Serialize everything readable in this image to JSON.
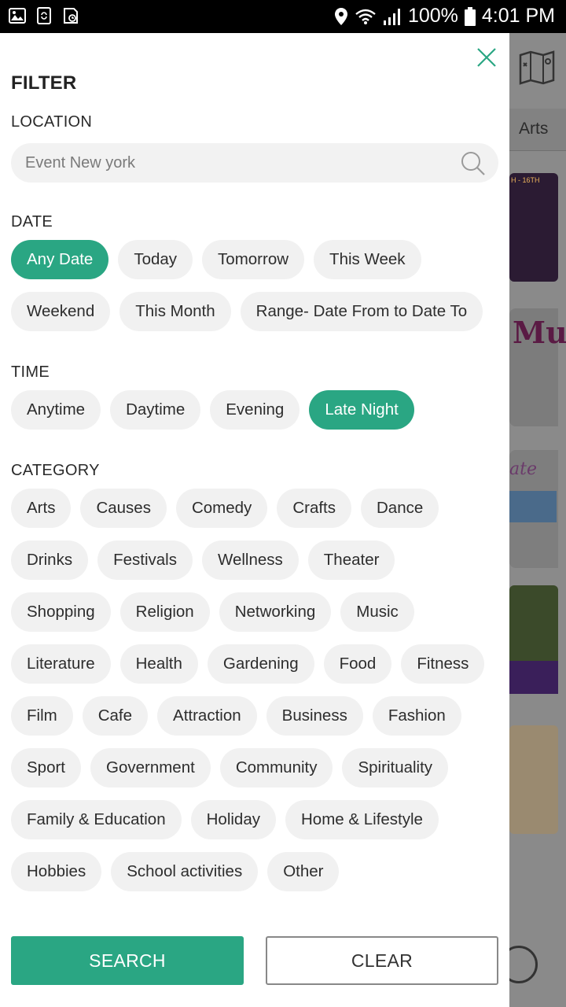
{
  "status_bar": {
    "battery": "100%",
    "time": "4:01 PM",
    "icons": [
      "gallery-icon",
      "sync-icon",
      "screenshot-icon",
      "location-icon",
      "wifi-icon",
      "signal-icon",
      "battery-icon"
    ]
  },
  "background_app": {
    "tab_label": "Arts",
    "card1_tag": "H - 16TH",
    "card2_text": "Mu",
    "card3_text": "ate"
  },
  "filter": {
    "title": "FILTER",
    "location": {
      "label": "LOCATION",
      "placeholder": "Event New york",
      "value": ""
    },
    "date": {
      "label": "DATE",
      "options": [
        "Any Date",
        "Today",
        "Tomorrow",
        "This Week",
        "Weekend",
        "This Month",
        "Range- Date From to Date To"
      ],
      "selected": "Any Date"
    },
    "time": {
      "label": "TIME",
      "options": [
        "Anytime",
        "Daytime",
        "Evening",
        "Late Night"
      ],
      "selected": "Late Night"
    },
    "category": {
      "label": "CATEGORY",
      "options": [
        "Arts",
        "Causes",
        "Comedy",
        "Crafts",
        "Dance",
        "Drinks",
        "Festivals",
        "Wellness",
        "Theater",
        "Shopping",
        "Religion",
        "Networking",
        "Music",
        "Literature",
        "Health",
        "Gardening",
        "Food",
        "Fitness",
        "Film",
        "Cafe",
        "Attraction",
        "Business",
        "Fashion",
        "Sport",
        "Government",
        "Community",
        "Spirituality",
        "Family & Education",
        "Holiday",
        "Home & Lifestyle",
        "Hobbies",
        "School activities",
        "Other"
      ]
    },
    "search_button": "SEARCH",
    "clear_button": "CLEAR"
  },
  "colors": {
    "accent": "#2aa683",
    "chip_bg": "#f1f1f1",
    "overlay": "#7d7d7d"
  }
}
